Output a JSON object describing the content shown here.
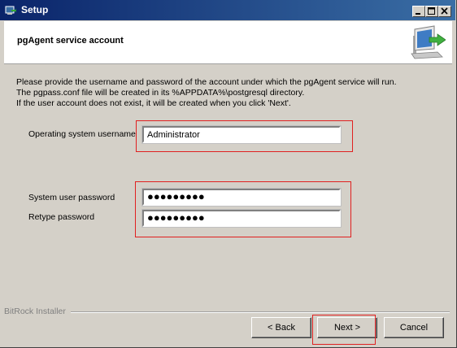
{
  "window": {
    "title": "Setup"
  },
  "header": {
    "title": "pgAgent service account"
  },
  "description": {
    "line1": "Please provide the username and password of the account under which the pgAgent service will run.",
    "line2": "The pgpass.conf file will be created in its %APPDATA%\\postgresql directory.",
    "line3": "If the user account does not exist, it will be created when you click 'Next'."
  },
  "form": {
    "username_label": "Operating system username",
    "username_value": "Administrator",
    "password_label": "System user password",
    "password_value": "●●●●●●●●●",
    "retype_label": "Retype password",
    "retype_value": "●●●●●●●●●"
  },
  "footer": {
    "installer_label": "BitRock Installer"
  },
  "buttons": {
    "back": "< Back",
    "next": "Next >",
    "cancel": "Cancel"
  },
  "colors": {
    "titlebar_start": "#0a246a",
    "titlebar_end": "#3a6ea5",
    "highlight": "#e02020",
    "dialog_bg": "#d4d0c8"
  },
  "icons": {
    "title": "setup-app-icon",
    "header": "computer-install-icon"
  }
}
